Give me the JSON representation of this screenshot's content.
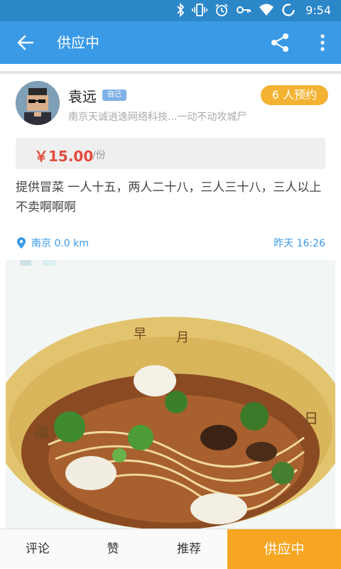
{
  "status_bar": {
    "time": "9:54",
    "icons": [
      "bluetooth-icon",
      "vibrate-icon",
      "alarm-icon",
      "key-icon",
      "wifi-icon",
      "sync-icon"
    ]
  },
  "app_bar": {
    "title": "供应中",
    "icons": [
      "back-arrow-icon",
      "share-icon",
      "more-vert-icon"
    ]
  },
  "post": {
    "user_name": "袁远",
    "self_badge": "自己",
    "reserve_badge": "6 人预约",
    "company": "南京天诚逍逸网络科技...一动不动攻城尸",
    "price": "￥15.00",
    "price_unit": "/份",
    "description": "提供冒菜 一人十五，两人二十八，三人三十八，三人以上不卖啊啊啊",
    "location": "南京 0.0 km",
    "time": "昨天 16:26"
  },
  "bottom_bar": {
    "comment": "评论",
    "like": "赞",
    "recommend": "推荐",
    "status": "供应中"
  },
  "colors": {
    "status_bar": "#2c87c9",
    "app_bar": "#3a9ae6",
    "price": "#e24a3b",
    "reserve_badge": "#f4b233",
    "status_button": "#f6a623",
    "link": "#3a9ae6"
  }
}
